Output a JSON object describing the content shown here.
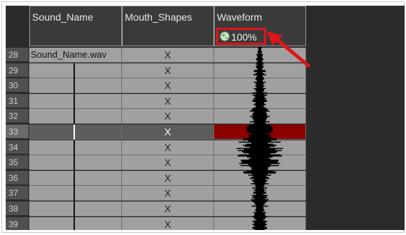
{
  "columns": {
    "sound_name": "Sound_Name",
    "mouth_shapes": "Mouth_Shapes",
    "waveform": "Waveform"
  },
  "waveform_zoom": "100%",
  "sound_file": "Sound_Name.wav",
  "rows": [
    {
      "num": "28",
      "mouth": "X"
    },
    {
      "num": "29",
      "mouth": "X"
    },
    {
      "num": "30",
      "mouth": "X"
    },
    {
      "num": "31",
      "mouth": "X"
    },
    {
      "num": "32",
      "mouth": "X"
    },
    {
      "num": "33",
      "mouth": "X"
    },
    {
      "num": "34",
      "mouth": "X"
    },
    {
      "num": "35",
      "mouth": "X"
    },
    {
      "num": "36",
      "mouth": "X"
    },
    {
      "num": "37",
      "mouth": "X"
    },
    {
      "num": "38",
      "mouth": "X"
    },
    {
      "num": "39",
      "mouth": "X"
    }
  ],
  "selected_row": "33",
  "colors": {
    "selected_waveform_cell": "#8b0000",
    "highlight": "#e0141a"
  },
  "icons": [
    "globe-icon",
    "arrow-icon"
  ]
}
